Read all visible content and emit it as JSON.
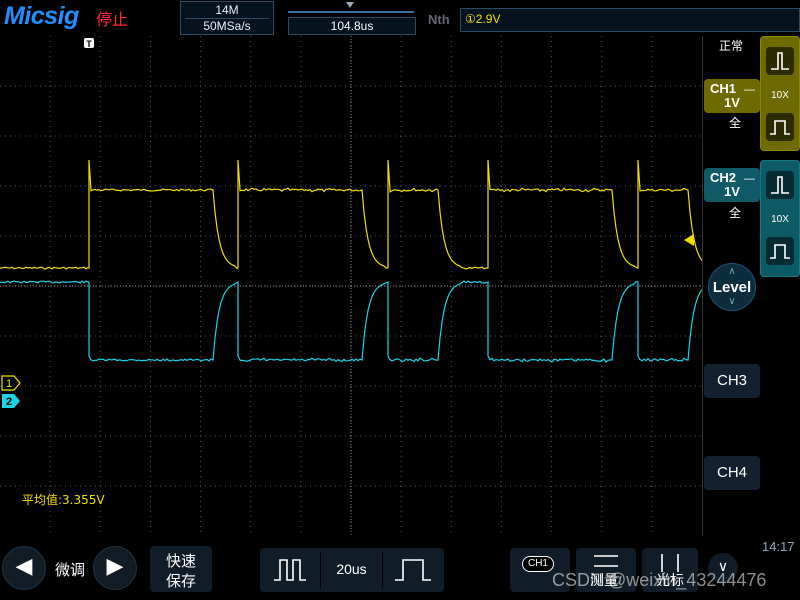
{
  "header": {
    "brand": "Micsig",
    "run_status": "停止",
    "memory_depth": "14M",
    "sample_rate": "50MSa/s",
    "trigger_delay": "104.8us",
    "nth_label": "Nth",
    "trigger_level": "①2.9V"
  },
  "screen": {
    "average_readout": "平均值:3.355V",
    "ch1_marker": "1",
    "ch2_marker": "2",
    "trigger_marker_glyph": "T"
  },
  "right_panel": {
    "mode": "正常",
    "ch1": {
      "name": "CH1",
      "dash": "—",
      "scale": "1V",
      "coupling": "全",
      "probe": "10X"
    },
    "ch2": {
      "name": "CH2",
      "dash": "—",
      "scale": "1V",
      "coupling": "全",
      "probe": "10X"
    },
    "level_label": "Level",
    "ch3_label": "CH3",
    "ch4_label": "CH4"
  },
  "bottom": {
    "prev_glyph": "◀",
    "next_glyph": "▶",
    "fine_label": "微调",
    "quick_save_line1": "快速",
    "quick_save_line2": "保存",
    "timebase": "20us",
    "measure_tag": "CH1",
    "measure_label": "测量",
    "cursor_label": "光标",
    "time": "14:17",
    "menu_glyph": "∨"
  },
  "watermark": "CSDN @weixin_43244476",
  "colors": {
    "ch1": "#f0e000",
    "ch2": "#19d3e6",
    "grid": "#5a5a5a",
    "brand": "#1e90ff",
    "stopped": "#ff2a2a"
  },
  "icons": {
    "ch1_edge_rise": "rising-edge-icon",
    "ch1_edge_fall": "pulse-icon",
    "ch2_edge_rise": "rising-edge-icon",
    "ch2_edge_fall": "pulse-icon"
  }
}
